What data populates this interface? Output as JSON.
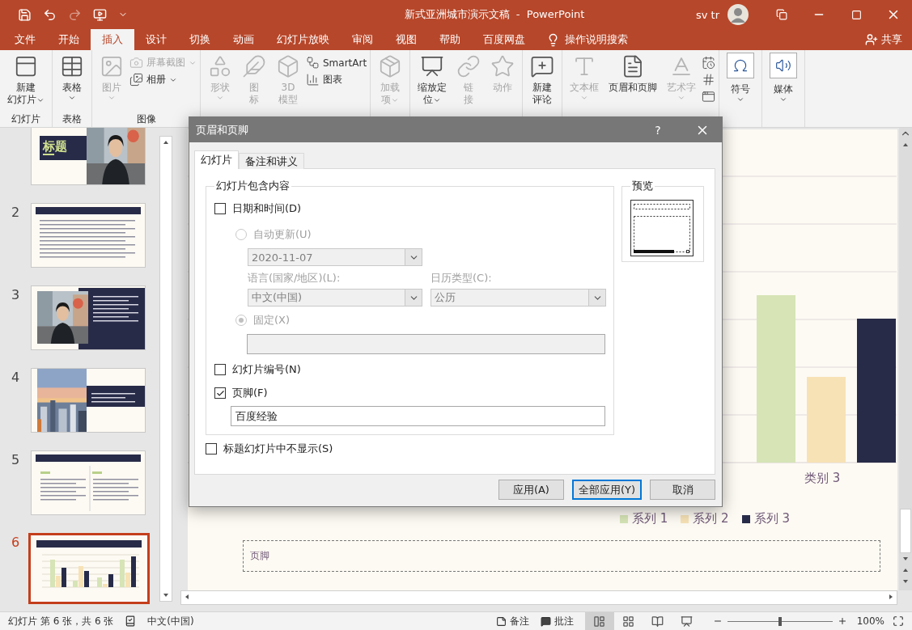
{
  "window": {
    "title": "新式亚洲城市演示文稿  -  PowerPoint",
    "user": "sv tr"
  },
  "quick_access": [
    {
      "disabled": false
    },
    {
      "disabled": false
    },
    {
      "disabled": true
    },
    {
      "disabled": false
    },
    {
      "disabled": false
    }
  ],
  "ribbon_tabs": [
    {
      "label": "文件",
      "selected": false
    },
    {
      "label": "开始",
      "selected": false
    },
    {
      "label": "插入",
      "selected": true
    },
    {
      "label": "设计",
      "selected": false
    },
    {
      "label": "切换",
      "selected": false
    },
    {
      "label": "动画",
      "selected": false
    },
    {
      "label": "幻灯片放映",
      "selected": false
    },
    {
      "label": "审阅",
      "selected": false
    },
    {
      "label": "视图",
      "selected": false
    },
    {
      "label": "帮助",
      "selected": false
    },
    {
      "label": "百度网盘",
      "selected": false
    }
  ],
  "tell_me": "操作说明搜索",
  "share": "共享",
  "ribbon_groups": [
    {
      "label": "幻灯片",
      "columns": [
        {
          "kind": "large",
          "lines": [
            "新建",
            "幻灯片"
          ],
          "disabled": false,
          "dropdown": true
        }
      ]
    },
    {
      "label": "表格",
      "columns": [
        {
          "kind": "large",
          "lines": [
            "表格"
          ],
          "disabled": false,
          "dropdown": true
        }
      ]
    },
    {
      "label": "图像",
      "columns": [
        {
          "kind": "large",
          "lines": [
            "图片"
          ],
          "disabled": true,
          "dropdown": true
        },
        {
          "kind": "stack",
          "items": [
            {
              "label": "屏幕截图",
              "disabled": true,
              "dropdown": true
            },
            {
              "label": "相册",
              "disabled": false,
              "dropdown": true
            }
          ]
        }
      ]
    },
    {
      "columns": [
        {
          "kind": "large",
          "lines": [
            "形状"
          ],
          "disabled": true,
          "dropdown": true
        },
        {
          "kind": "large",
          "lines": [
            "图",
            "标"
          ],
          "disabled": true,
          "dropdown": false
        },
        {
          "kind": "large",
          "lines": [
            "3D",
            "模型"
          ],
          "disabled": true,
          "dropdown": false
        },
        {
          "kind": "stack",
          "items": [
            {
              "label": "SmartArt",
              "disabled": false,
              "dropdown": false
            },
            {
              "label": "图表",
              "disabled": false,
              "dropdown": false
            }
          ]
        }
      ]
    },
    {
      "columns": [
        {
          "kind": "large",
          "lines": [
            "加载",
            "项"
          ],
          "disabled": true,
          "dropdown": true
        }
      ]
    },
    {
      "columns": [
        {
          "kind": "large",
          "lines": [
            "缩放定",
            "位"
          ],
          "disabled": false,
          "dropdown": true
        },
        {
          "kind": "large",
          "lines": [
            "链",
            "接"
          ],
          "disabled": true,
          "dropdown": false
        },
        {
          "kind": "large",
          "lines": [
            "动作"
          ],
          "disabled": true,
          "dropdown": false
        }
      ]
    },
    {
      "columns": [
        {
          "kind": "large",
          "lines": [
            "新建",
            "评论"
          ],
          "disabled": false,
          "dropdown": false
        }
      ]
    },
    {
      "columns": [
        {
          "kind": "large",
          "lines": [
            "文本框"
          ],
          "disabled": true,
          "dropdown": true
        },
        {
          "kind": "large",
          "lines": [
            "页眉和页脚"
          ],
          "disabled": false,
          "dropdown": false
        },
        {
          "kind": "large",
          "lines": [
            "艺术字"
          ],
          "disabled": true,
          "dropdown": true
        },
        {
          "kind": "stack",
          "items": [
            {
              "disabled": false
            },
            {
              "disabled": false
            },
            {
              "disabled": false
            }
          ]
        }
      ]
    },
    {
      "columns": [
        {
          "kind": "large",
          "lines": [
            "符号"
          ],
          "disabled": false,
          "dropdown": true
        }
      ]
    },
    {
      "columns": [
        {
          "kind": "large",
          "lines": [
            "媒体"
          ],
          "disabled": false,
          "dropdown": true
        }
      ]
    }
  ],
  "slides": [
    {
      "kind": "title",
      "title": "标题",
      "selected": false
    },
    {
      "number": "2",
      "kind": "bullets",
      "selected": false
    },
    {
      "number": "3",
      "kind": "photo-person",
      "selected": false
    },
    {
      "number": "4",
      "kind": "photo-city",
      "selected": false
    },
    {
      "number": "5",
      "kind": "two-column",
      "selected": false
    },
    {
      "number": "6",
      "kind": "chart",
      "selected": true
    }
  ],
  "slide": {
    "category": "类别 3",
    "legend": [
      {
        "label": "系列 1",
        "color": "#d6e4b6"
      },
      {
        "label": "系列 2",
        "color": "#f7e2b6"
      },
      {
        "label": "系列 3",
        "color": "#282b48"
      }
    ],
    "footer_placeholder": "页脚"
  },
  "dialog": {
    "title": "页眉和页脚",
    "help": "?",
    "tabs": [
      {
        "label": "幻灯片",
        "selected": true
      },
      {
        "label": "备注和讲义",
        "selected": false
      }
    ],
    "group_title": "幻灯片包含内容",
    "date_time": {
      "label": "日期和时间(D)",
      "checked": false
    },
    "auto_update": {
      "label": "自动更新(U)",
      "selected": false,
      "disabled": true
    },
    "date_value": "2020-11-07",
    "language_label": "语言(国家/地区)(L):",
    "language_value": "中文(中国)",
    "calendar_label": "日历类型(C):",
    "calendar_value": "公历",
    "fixed": {
      "label": "固定(X)",
      "selected": true,
      "disabled": true
    },
    "slide_number": {
      "label": "幻灯片编号(N)",
      "checked": false
    },
    "footer": {
      "label": "页脚(F)",
      "checked": true,
      "value": "百度经验"
    },
    "preview_title": "预览",
    "hide_on_title": {
      "label": "标题幻灯片中不显示(S)",
      "checked": false
    },
    "buttons": [
      {
        "label": "应用(A)",
        "default": false
      },
      {
        "label": "全部应用(Y)",
        "default": true
      },
      {
        "label": "取消",
        "default": false
      }
    ]
  },
  "status_bar": {
    "slide_info": "幻灯片 第 6 张，共 6 张",
    "language": "中文(中国)",
    "notes": "备注",
    "comments": "批注",
    "views": [
      {
        "selected": true
      },
      {
        "selected": false
      },
      {
        "selected": false
      },
      {
        "selected": false
      }
    ],
    "zoom": {
      "level": 0.5,
      "reading": "100%"
    }
  }
}
